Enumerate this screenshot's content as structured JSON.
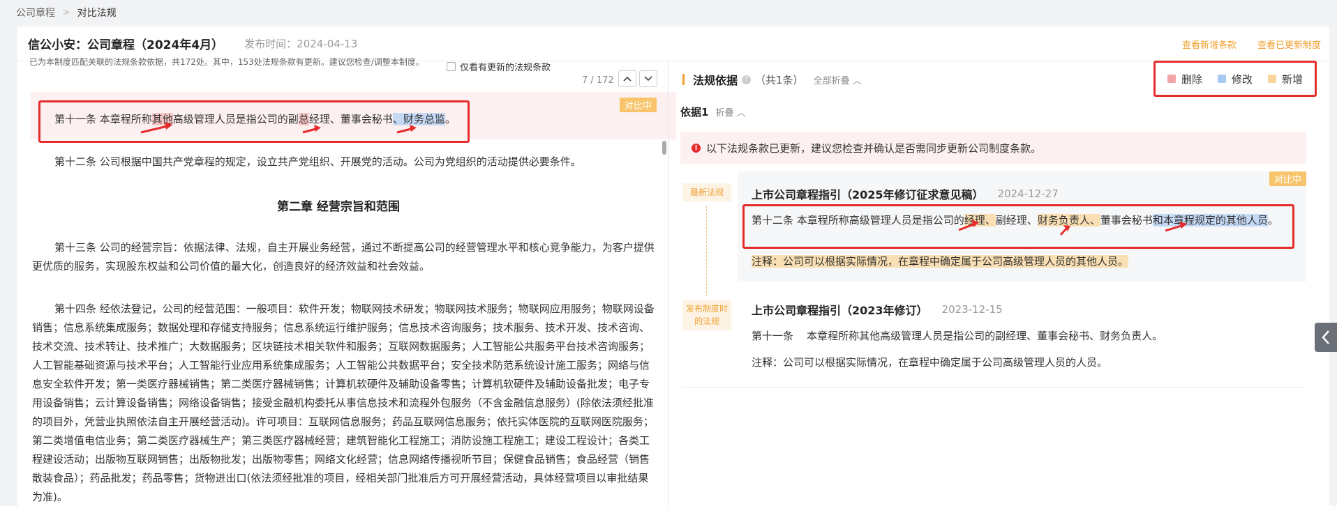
{
  "breadcrumb": {
    "parent": "公司章程",
    "sep": ">",
    "current": "对比法规"
  },
  "header": {
    "title": "信公小安：公司章程（2024年4月）",
    "pub_time": "发布时间：2024-04-13",
    "link_view_new": "查看新增条款",
    "link_view_updated": "查看已更新制度"
  },
  "left": {
    "info": "已为本制度匹配关联的法规条款依据，共172处。其中，153处法规条款有更新。建议您检查/调整本制度。",
    "only_updated_label": "仅看有更新的法规条款",
    "pager": "7 / 172",
    "up_icon": "chevron-up-icon",
    "down_icon": "chevron-down-icon",
    "compare_tag": "对比中",
    "art11": {
      "p1": "第十一条  本章程所称",
      "hl1": "其他",
      "p2": "高级管理人员是指公司的副",
      "hl2": "总",
      "p3": "经理、董事会秘书",
      "hl3": "、财务总监",
      "p4": "。"
    },
    "art12": "第十二条  公司根据中国共产党章程的规定，设立共产党组织、开展党的活动。公司为党组织的活动提供必要条件。",
    "chapter2": "第二章  经营宗旨和范围",
    "art13": "第十三条  公司的经营宗旨：依据法律、法规，自主开展业务经营，通过不断提高公司的经营管理水平和核心竞争能力，为客户提供更优质的服务，实现股东权益和公司价值的最大化，创造良好的经济效益和社会效益。",
    "art14": "第十四条  经依法登记，公司的经营范围：一般项目：软件开发；物联网技术研发；物联网技术服务；物联网应用服务；物联网设备销售；信息系统集成服务；数据处理和存储支持服务；信息系统运行维护服务；信息技术咨询服务；技术服务、技术开发、技术咨询、技术交流、技术转让、技术推广；大数据服务；区块链技术相关软件和服务；互联网数据服务；人工智能公共服务平台技术咨询服务；人工智能基础资源与技术平台；人工智能行业应用系统集成服务；人工智能公共数据平台；安全技术防范系统设计施工服务；网络与信息安全软件开发；第一类医疗器械销售；第二类医疗器械销售；计算机软硬件及辅助设备零售；计算机软硬件及辅助设备批发；电子专用设备销售；云计算设备销售；网络设备销售；接受金融机构委托从事信息技术和流程外包服务（不含金融信息服务）(除依法须经批准的项目外，凭营业执照依法自主开展经营活动)。许可项目：互联网信息服务；药品互联网信息服务；依托实体医院的互联网医院服务；第二类增值电信业务；第二类医疗器械生产；第三类医疗器械经营；建筑智能化工程施工；消防设施工程施工；建设工程设计；各类工程建设活动；出版物互联网销售；出版物批发；出版物零售；网络文化经营；信息网络传播视听节目；保健食品销售；食品经营（销售散装食品）；药品批发；药品零售；货物进出口(依法须经批准的项目，经相关部门批准后方可开展经营活动，具体经营项目以审批结果为准)。"
  },
  "right": {
    "title": "法规依据",
    "count": "（共1条）",
    "fold_all": "全部折叠 ︿",
    "legend": [
      {
        "label": "删除",
        "color": "#f4a6a6"
      },
      {
        "label": "修改",
        "color": "#a9c8f2"
      },
      {
        "label": "新增",
        "color": "#f8d59a"
      }
    ],
    "basis_label": "依据1",
    "basis_fold": "折叠 ︿",
    "alert": "以下法规条款已更新，建议您检查并确认是否需同步更新公司制度条款。",
    "tag_latest": "最新法规",
    "tag_at_publish": "发布制度时的法规",
    "compare_tag": "对比中",
    "law1": {
      "name": "上市公司章程指引（2025年修订征求意见稿）",
      "date": "2024-12-27",
      "t1": "第十二条 本章程所称高级管理人员是指公司的",
      "h1": "经理、",
      "t2": "副经理、",
      "h2": "财务负责人、",
      "t3": "董事会秘书",
      "h3": "和本章程规定的其他人员",
      "t4": "。",
      "note": "注释：公司可以根据实际情况，在章程中确定属于公司高级管理人员的其他人员。"
    },
    "law2": {
      "name": "上市公司章程指引（2023年修订）",
      "date": "2023-12-15",
      "text": "第十一条    本章程所称其他高级管理人员是指公司的副经理、董事会秘书、财务负责人。",
      "note": "注释：公司可以根据实际情况，在章程中确定属于公司高级管理人员的人员。"
    }
  },
  "side_handle_icon": "chevron-left-icon"
}
